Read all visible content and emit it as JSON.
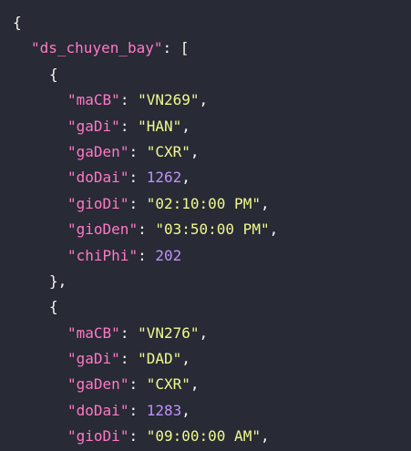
{
  "json_view": {
    "root_key": "ds_chuyen_bay",
    "flights": [
      {
        "maCB_key": "maCB",
        "maCB": "VN269",
        "gaDi_key": "gaDi",
        "gaDi": "HAN",
        "gaDen_key": "gaDen",
        "gaDen": "CXR",
        "doDai_key": "doDai",
        "doDai": "1262",
        "gioDi_key": "gioDi",
        "gioDi": "02:10:00 PM",
        "gioDen_key": "gioDen",
        "gioDen": "03:50:00 PM",
        "chiPhi_key": "chiPhi",
        "chiPhi": "202"
      },
      {
        "maCB_key": "maCB",
        "maCB": "VN276",
        "gaDi_key": "gaDi",
        "gaDi": "DAD",
        "gaDen_key": "gaDen",
        "gaDen": "CXR",
        "doDai_key": "doDai",
        "doDai": "1283",
        "gioDi_key": "gioDi",
        "gioDi": "09:00:00 AM"
      }
    ]
  },
  "colors": {
    "background": "#282a36",
    "key": "#ff79c6",
    "string": "#f1fa8c",
    "number": "#bd93f9",
    "punctuation": "#f8f8f2"
  }
}
